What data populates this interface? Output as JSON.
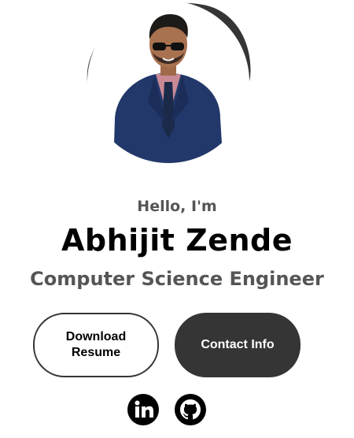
{
  "profile": {
    "photo_icon": "profile-photo",
    "greeting": "Hello, I'm",
    "name": "Abhijit Zende",
    "title": "Computer Science Engineer"
  },
  "buttons": {
    "download_label": "Download Resume",
    "contact_label": "Contact Info"
  },
  "social": [
    {
      "icon": "linkedin-icon"
    },
    {
      "icon": "github-icon"
    }
  ],
  "colors": {
    "dark": "#353535",
    "text_muted": "#555555",
    "text_main": "#000000",
    "background": "#ffffff"
  }
}
